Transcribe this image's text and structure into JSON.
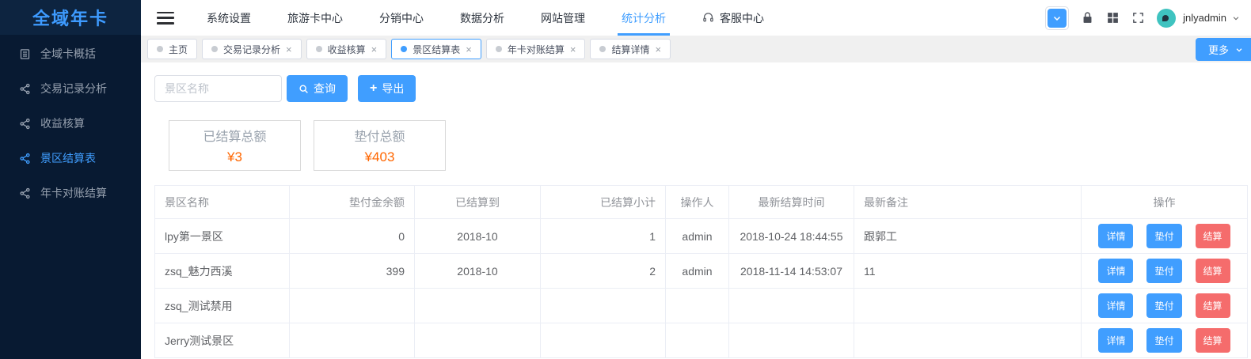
{
  "colors": {
    "accent": "#409eff",
    "danger": "#f56c6c",
    "value_orange": "#ff6600",
    "sidebar_bg": "#081a32",
    "sidebar_header_bg": "#0d2440",
    "avatar_teal": "#3fc3c0"
  },
  "ui": {
    "close_glyph": "×",
    "plus_glyph": "+"
  },
  "sidebar": {
    "logo": "全域年卡",
    "items": [
      {
        "label": "全域卡概括",
        "icon": "list-icon",
        "active": false
      },
      {
        "label": "交易记录分析",
        "icon": "share-icon",
        "active": false
      },
      {
        "label": "收益核算",
        "icon": "share-icon",
        "active": false
      },
      {
        "label": "景区结算表",
        "icon": "share-icon",
        "active": true
      },
      {
        "label": "年卡对账结算",
        "icon": "share-icon",
        "active": false
      }
    ]
  },
  "topnav": {
    "items": [
      {
        "label": "系统设置",
        "active": false
      },
      {
        "label": "旅游卡中心",
        "active": false
      },
      {
        "label": "分销中心",
        "active": false
      },
      {
        "label": "数据分析",
        "active": false
      },
      {
        "label": "网站管理",
        "active": false
      },
      {
        "label": "统计分析",
        "active": true
      },
      {
        "label": "客服中心",
        "active": false,
        "icon": "headset-icon"
      }
    ],
    "username": "jnlyadmin"
  },
  "tabs": [
    {
      "label": "主页",
      "closable": false,
      "active": false
    },
    {
      "label": "交易记录分析",
      "closable": true,
      "active": false
    },
    {
      "label": "收益核算",
      "closable": true,
      "active": false
    },
    {
      "label": "景区结算表",
      "closable": true,
      "active": true
    },
    {
      "label": "年卡对账结算",
      "closable": true,
      "active": false
    },
    {
      "label": "结算详情",
      "closable": true,
      "active": false
    }
  ],
  "tabbar": {
    "more_label": "更多"
  },
  "toolbar": {
    "search_placeholder": "景区名称",
    "query_label": "查询",
    "export_label": "导出"
  },
  "summary_cards": [
    {
      "label": "已结算总额",
      "value": "¥3"
    },
    {
      "label": "垫付总额",
      "value": "¥403"
    }
  ],
  "table": {
    "columns": [
      "景区名称",
      "垫付金余额",
      "已结算到",
      "已结算小计",
      "操作人",
      "最新结算时间",
      "最新备注",
      "操作"
    ],
    "action_labels": [
      "详情",
      "垫付",
      "结算"
    ],
    "rows": [
      {
        "name": "lpy第一景区",
        "balance": "0",
        "settled_to": "2018-10",
        "subtotal": "1",
        "operator": "admin",
        "time": "2018-10-24 18:44:55",
        "note": "跟郭工"
      },
      {
        "name": "zsq_魅力西溪",
        "balance": "399",
        "settled_to": "2018-10",
        "subtotal": "2",
        "operator": "admin",
        "time": "2018-11-14 14:53:07",
        "note": "11"
      },
      {
        "name": "zsq_测试禁用",
        "balance": "",
        "settled_to": "",
        "subtotal": "",
        "operator": "",
        "time": "",
        "note": ""
      },
      {
        "name": "Jerry测试景区",
        "balance": "",
        "settled_to": "",
        "subtotal": "",
        "operator": "",
        "time": "",
        "note": ""
      }
    ]
  }
}
